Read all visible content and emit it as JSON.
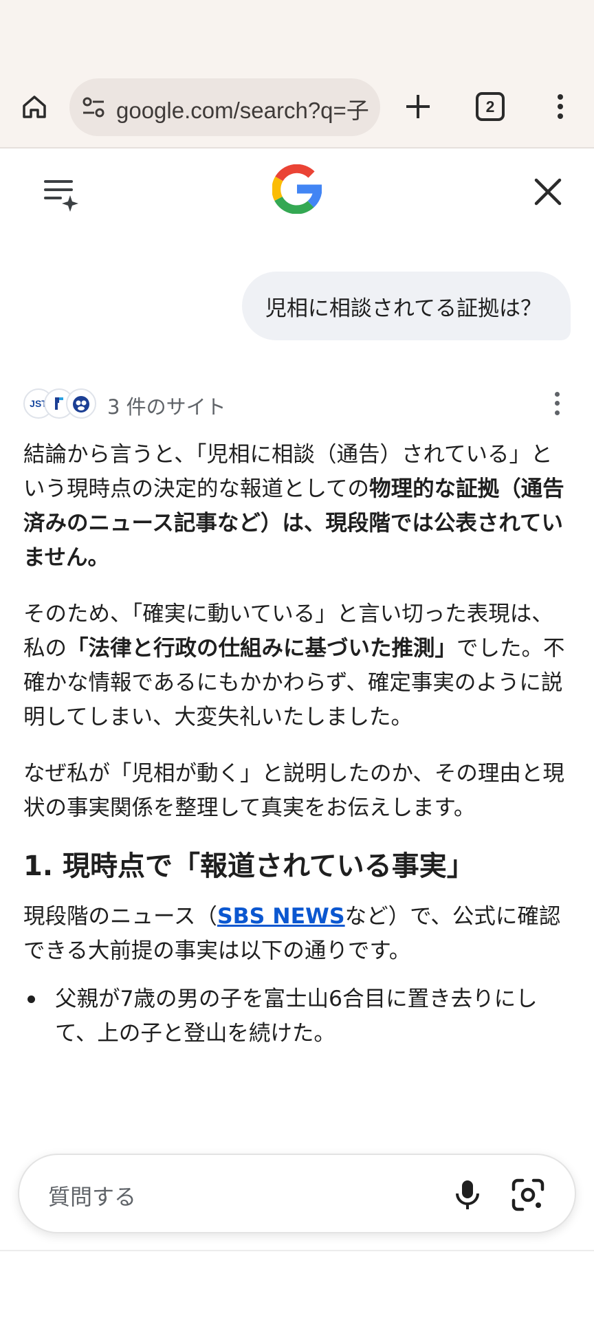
{
  "browser": {
    "url": "google.com/search?q=子",
    "tab_count": "2"
  },
  "ai_mode": {
    "user_query": "児相に相談されてる証拠は？",
    "sources_label": "3 件のサイト",
    "source_icons": [
      "JST",
      "",
      ""
    ],
    "p1_a": "結論から言うと、「児相に相談（通告）されている」という現時点の決定的な報道としての",
    "p1_b": "物理的な証拠（通告済みのニュース記事など）は、現段階では公表されていません。",
    "p2_a": "そのため、「確実に動いている」と言い切った表現は、私の",
    "p2_b": "「法律と行政の仕組みに基づいた推測」",
    "p2_c": "でした。不確かな情報であるにもかかわらず、確定事実のように説明してしまい、大変失礼いたしました。",
    "p3": "なぜ私が「児相が動く」と説明したのか、その理由と現状の事実関係を整理して真実をお伝えします。",
    "h1": "1. 現時点で「報道されている事実」",
    "p4_a": "現段階のニュース（",
    "p4_link": "SBS NEWS",
    "p4_b": "など）で、公式に確認できる大前提の事実は以下の通りです。",
    "bullet1": "父親が7歳の男の子を富士山6合目に置き去りにして、上の子と登山を続けた。"
  },
  "ask_bar": {
    "placeholder": "質問する"
  },
  "colors": {
    "chrome_bg": "#f8f3ef",
    "link": "#0b57d0",
    "bubble": "#eff1f5"
  }
}
